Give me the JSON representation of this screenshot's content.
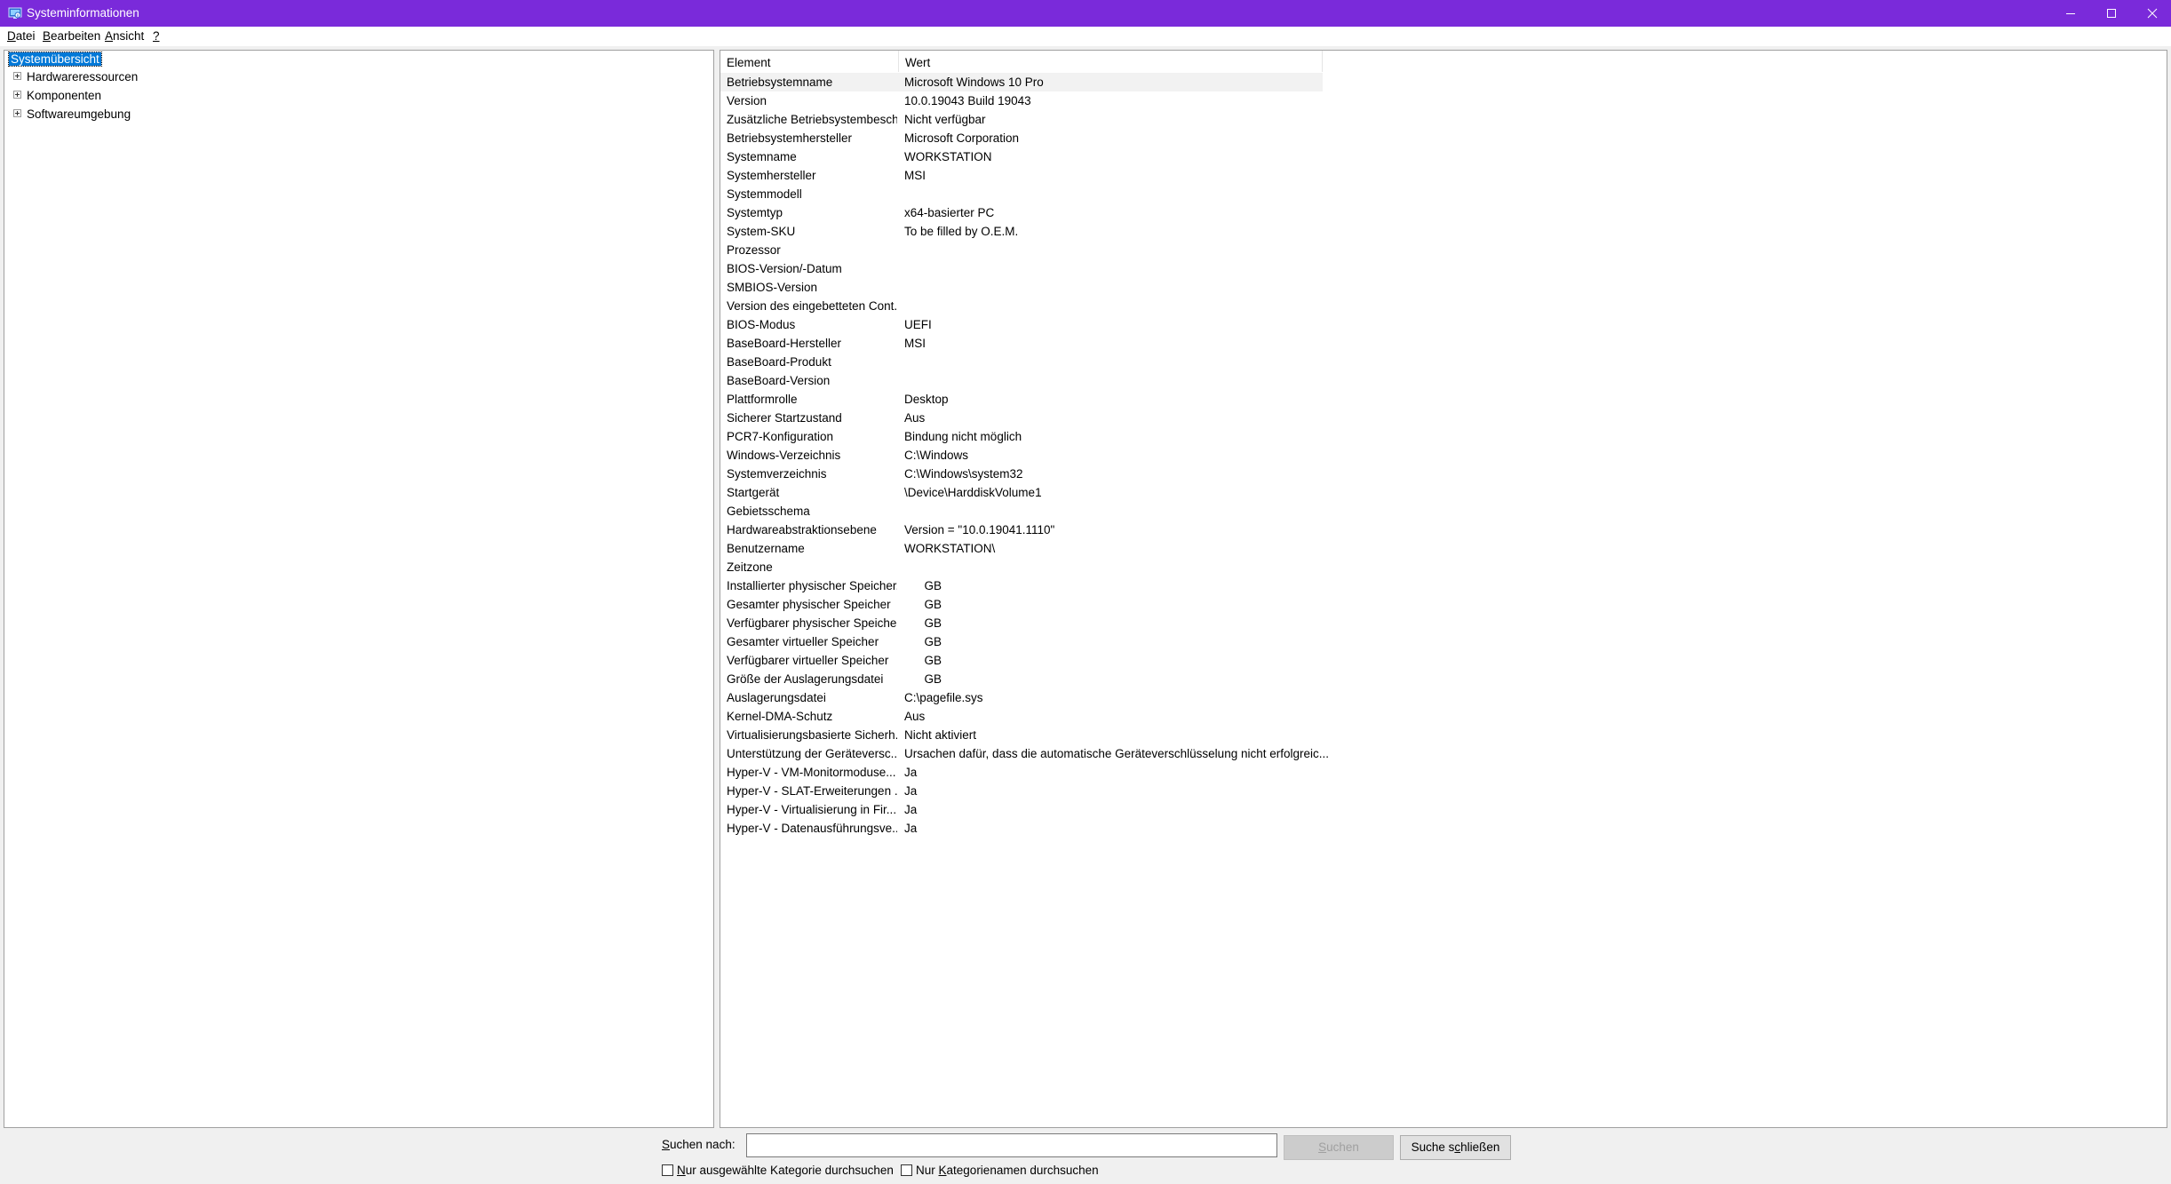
{
  "window": {
    "title": "Systeminformationen",
    "accent_color": "#7a2ada",
    "controls": [
      "minimize-icon",
      "maximize-icon",
      "close-icon"
    ]
  },
  "menu": [
    {
      "label": "Datei",
      "accel": "D",
      "rest": "atei"
    },
    {
      "label": "Bearbeiten",
      "accel": "B",
      "rest": "earbeiten"
    },
    {
      "label": "Ansicht",
      "accel": "A",
      "rest": "nsicht"
    },
    {
      "label": "?",
      "accel": "?",
      "rest": ""
    }
  ],
  "tree": {
    "root": "Systemübersicht",
    "children": [
      "Hardwareressourcen",
      "Komponenten",
      "Softwareumgebung"
    ]
  },
  "table": {
    "columns": [
      "Element",
      "Wert"
    ],
    "rows": [
      [
        "Betriebsystemname",
        "Microsoft Windows 10 Pro"
      ],
      [
        "Version",
        "10.0.19043 Build 19043"
      ],
      [
        "Zusätzliche Betriebsystembesch...",
        "Nicht verfügbar"
      ],
      [
        "Betriebsystemhersteller",
        "Microsoft Corporation"
      ],
      [
        "Systemname",
        "WORKSTATION"
      ],
      [
        "Systemhersteller",
        "MSI"
      ],
      [
        "Systemmodell",
        ""
      ],
      [
        "Systemtyp",
        "x64-basierter PC"
      ],
      [
        "System-SKU",
        "To be filled by O.E.M."
      ],
      [
        "Prozessor",
        ""
      ],
      [
        "BIOS-Version/-Datum",
        ""
      ],
      [
        "SMBIOS-Version",
        ""
      ],
      [
        "Version des eingebetteten Cont...",
        ""
      ],
      [
        "BIOS-Modus",
        "UEFI"
      ],
      [
        "BaseBoard-Hersteller",
        "MSI"
      ],
      [
        "BaseBoard-Produkt",
        ""
      ],
      [
        "BaseBoard-Version",
        ""
      ],
      [
        "Plattformrolle",
        "Desktop"
      ],
      [
        "Sicherer Startzustand",
        "Aus"
      ],
      [
        "PCR7-Konfiguration",
        "Bindung nicht möglich"
      ],
      [
        "Windows-Verzeichnis",
        "C:\\Windows"
      ],
      [
        "Systemverzeichnis",
        "C:\\Windows\\system32"
      ],
      [
        "Startgerät",
        "\\Device\\HarddiskVolume1"
      ],
      [
        "Gebietsschema",
        ""
      ],
      [
        "Hardwareabstraktionsebene",
        "Version = \"10.0.19041.1110\""
      ],
      [
        "Benutzername",
        "WORKSTATION\\"
      ],
      [
        "Zeitzone",
        ""
      ],
      [
        "Installierter physischer Speicher...",
        "      GB"
      ],
      [
        "Gesamter physischer Speicher",
        "      GB"
      ],
      [
        "Verfügbarer physischer Speicher",
        "      GB"
      ],
      [
        "Gesamter virtueller Speicher",
        "      GB"
      ],
      [
        "Verfügbarer virtueller Speicher",
        "      GB"
      ],
      [
        "Größe der Auslagerungsdatei",
        "      GB"
      ],
      [
        "Auslagerungsdatei",
        "C:\\pagefile.sys"
      ],
      [
        "Kernel-DMA-Schutz",
        "Aus"
      ],
      [
        "Virtualisierungsbasierte Sicherh...",
        "Nicht aktiviert"
      ],
      [
        "Unterstützung der Geräteversc...",
        "Ursachen dafür, dass die automatische Geräteverschlüsselung nicht erfolgreic..."
      ],
      [
        "Hyper-V - VM-Monitormoduse...",
        "Ja"
      ],
      [
        "Hyper-V - SLAT-Erweiterungen ...",
        "Ja"
      ],
      [
        "Hyper-V - Virtualisierung in Fir...",
        "Ja"
      ],
      [
        "Hyper-V - Datenausführungsve...",
        "Ja"
      ]
    ]
  },
  "search": {
    "label_accel": "S",
    "label_rest": "uchen nach:",
    "value": "",
    "search_button_accel": "S",
    "search_button_rest": "uchen",
    "close_button_pre": "Suche s",
    "close_button_accel": "c",
    "close_button_post": "hließen",
    "option_selected_accel": "N",
    "option_selected_rest": "ur ausgewählte Kategorie durchsuchen",
    "option_names_pre": "Nur ",
    "option_names_accel": "K",
    "option_names_post": "ategorienamen durchsuchen"
  }
}
